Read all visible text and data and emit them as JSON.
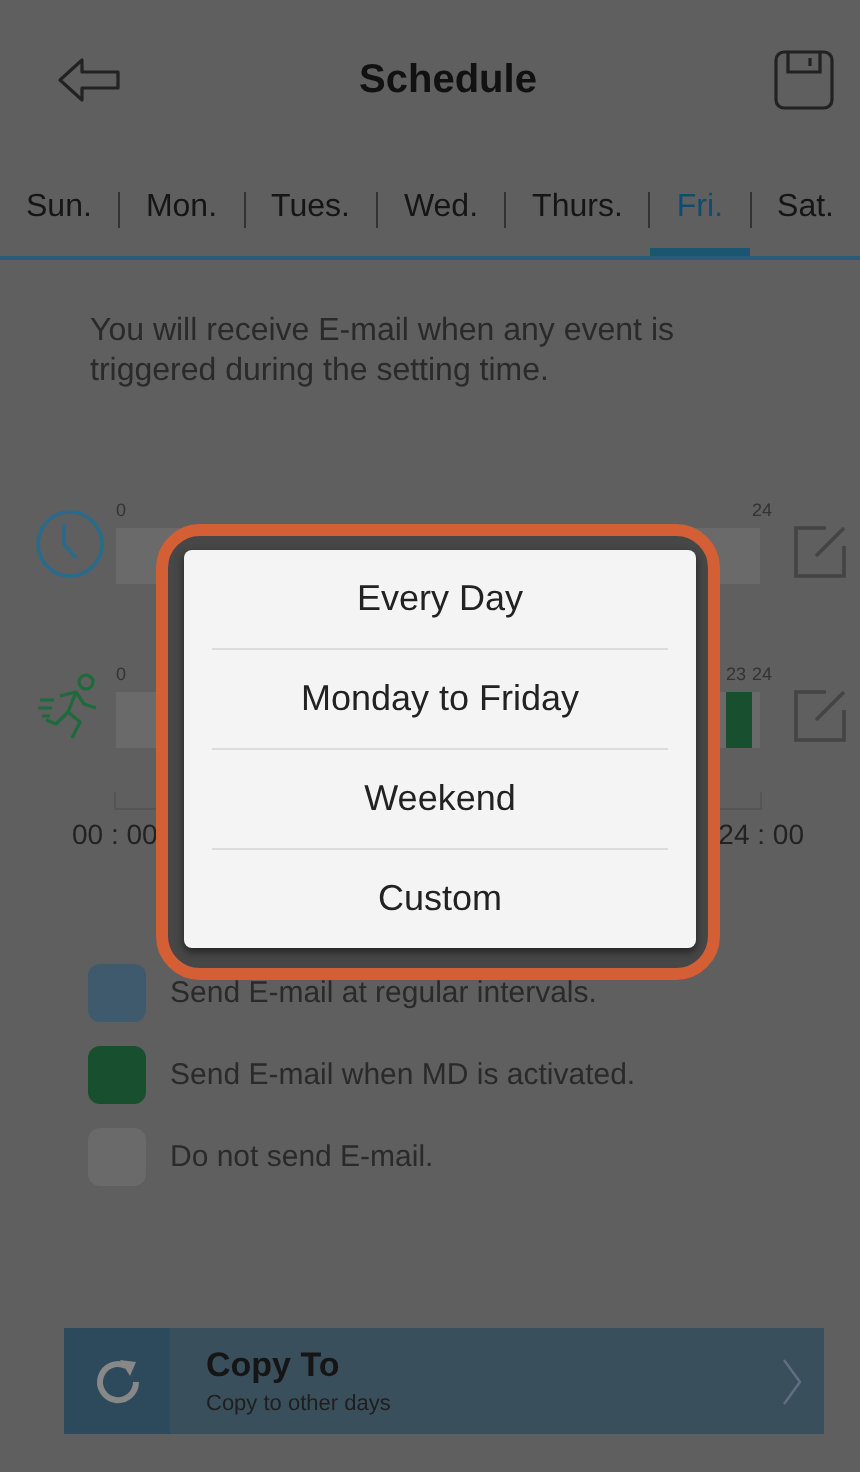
{
  "header": {
    "title": "Schedule"
  },
  "tabs": [
    {
      "label": "Sun.",
      "selected": false
    },
    {
      "label": "Mon.",
      "selected": false
    },
    {
      "label": "Tues.",
      "selected": false
    },
    {
      "label": "Wed.",
      "selected": false
    },
    {
      "label": "Thurs.",
      "selected": false
    },
    {
      "label": "Fri.",
      "selected": true
    },
    {
      "label": "Sat.",
      "selected": false
    }
  ],
  "description": "You will receive E-mail when any event is triggered during the setting time.",
  "timelines": [
    {
      "kind": "interval",
      "ticks": [
        {
          "label": "0",
          "event": false
        },
        {
          "label": "24",
          "event": false
        }
      ]
    },
    {
      "kind": "motion",
      "ticks": [
        {
          "label": "0",
          "event": false
        },
        {
          "label": "23",
          "event": true
        },
        {
          "label": "24",
          "event": false
        }
      ]
    }
  ],
  "axis": {
    "start": "00 : 00",
    "end": "24 : 00"
  },
  "legend": [
    {
      "color": "#3e5a6c",
      "text": "Send E-mail at regular intervals."
    },
    {
      "color": "#18502f",
      "text": "Send E-mail when MD is activated."
    },
    {
      "color": "#6a6a6a",
      "text": "Do not send E-mail."
    }
  ],
  "copy_bar": {
    "title": "Copy To",
    "subtitle": "Copy to other days"
  },
  "dialog": {
    "options": [
      "Every Day",
      "Monday to Friday",
      "Weekend",
      "Custom"
    ]
  }
}
